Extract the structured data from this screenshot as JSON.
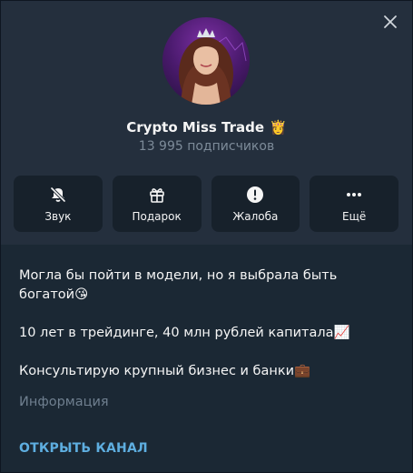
{
  "channel": {
    "name": "Crypto Miss Trade",
    "name_emoji": "👸",
    "subscribers": "13 995 подписчиков"
  },
  "actions": [
    {
      "label": "Звук",
      "icon": "bell-muted-icon"
    },
    {
      "label": "Подарок",
      "icon": "gift-icon"
    },
    {
      "label": "Жалоба",
      "icon": "report-icon"
    },
    {
      "label": "Ещё",
      "icon": "more-icon"
    }
  ],
  "description": {
    "line1": "Могла бы пойти в модели, но я выбрала быть",
    "line2": "богатой",
    "line2_emoji": "😘",
    "line3": "10 лет в трейдинге, 40 млн рублей капитала",
    "line3_emoji": "📈",
    "line4": "Консультирую крупный бизнес и банки",
    "line4_emoji": "💼"
  },
  "info_label": "Информация",
  "open_channel_label": "ОТКРЫТЬ КАНАЛ",
  "colors": {
    "background": "#17212b",
    "header": "#242f3d",
    "accent": "#5eaee0",
    "muted": "#7d8b99"
  }
}
